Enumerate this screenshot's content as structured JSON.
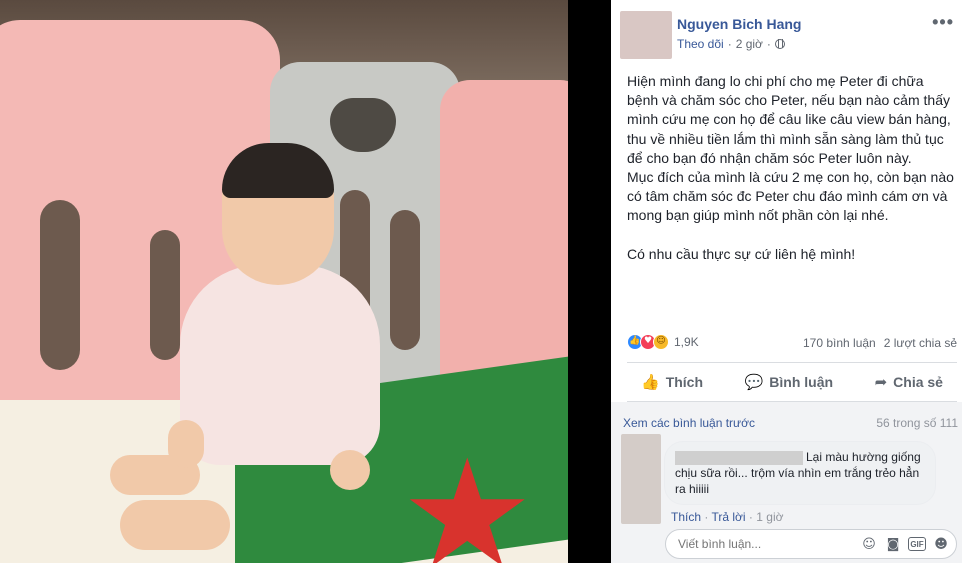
{
  "post": {
    "author": "Nguyen Bich Hang",
    "follow_label": "Theo dõi",
    "separator": "·",
    "time": "2 giờ",
    "paragraph1": "Hiện mình đang lo chi phí cho mẹ Peter đi chữa bệnh và chăm sóc cho Peter, nếu bạn nào cảm thấy mình cứu mẹ con họ để câu like câu view bán hàng, thu về nhiều tiền lắm thì mình sẵn sàng làm thủ tục để cho bạn đó nhận chăm sóc Peter luôn này.",
    "paragraph2": "Mục đích của mình là cứu 2 mẹ con họ, còn bạn nào có tâm chăm sóc đc Peter chu đáo mình cám ơn và mong bạn giúp mình nốt phần còn lại nhé.",
    "paragraph3": "Có nhu cầu thực sự cứ liên hệ mình!"
  },
  "stats": {
    "reaction_count": "1,9K",
    "comments": "170 bình luận",
    "shares": "2 lượt chia sẻ",
    "reactions": [
      "like-icon",
      "love-icon",
      "haha-icon"
    ]
  },
  "actions": {
    "like": "Thích",
    "comment": "Bình luận",
    "share": "Chia sẻ"
  },
  "comments": {
    "view_previous": "Xem các bình luận trước",
    "count": "56 trong số 111",
    "first": {
      "text_line1": "Lại màu hường giống",
      "text_rest": "chịu sữa rồi... trộm vía nhìn em trắng trẻo hẳn ra hiiiii",
      "like": "Thích",
      "reply": "Trả lời",
      "separator": "·",
      "time": "1 giờ"
    },
    "composer_placeholder": "Viết bình luận..."
  },
  "colors": {
    "link": "#385898",
    "muted": "#616770",
    "accent_like": "#2e89ff"
  }
}
